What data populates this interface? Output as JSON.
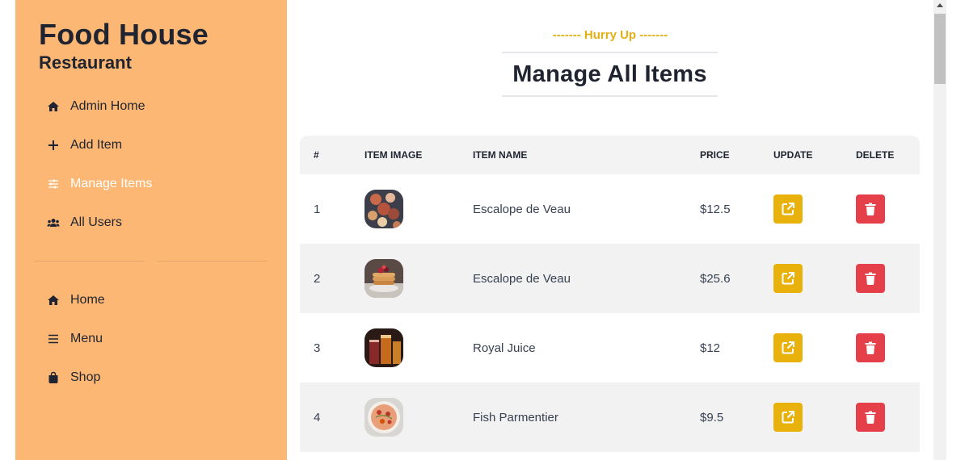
{
  "brand": {
    "title": "Food House",
    "subtitle": "Restaurant"
  },
  "sidebar": {
    "admin_items": [
      {
        "label": "Admin Home",
        "icon": "home-icon"
      },
      {
        "label": "Add Item",
        "icon": "plus-icon"
      },
      {
        "label": "Manage Items",
        "icon": "sliders-icon",
        "active": true
      },
      {
        "label": "All Users",
        "icon": "users-icon"
      }
    ],
    "main_items": [
      {
        "label": "Home",
        "icon": "home-icon"
      },
      {
        "label": "Menu",
        "icon": "menu-icon"
      },
      {
        "label": "Shop",
        "icon": "shopping-bag-icon"
      }
    ]
  },
  "header": {
    "subtitle": "------- Hurry Up -------",
    "title": "Manage All Items"
  },
  "table": {
    "columns": [
      "#",
      "ITEM IMAGE",
      "ITEM NAME",
      "PRICE",
      "UPDATE",
      "DELETE"
    ],
    "rows": [
      {
        "index": "1",
        "name": "Escalope de Veau",
        "price": "$12.5",
        "image": "food-platter-image"
      },
      {
        "index": "2",
        "name": "Escalope de Veau",
        "price": "$25.6",
        "image": "pancake-stack-image"
      },
      {
        "index": "3",
        "name": "Royal Juice",
        "price": "$12",
        "image": "drinks-image"
      },
      {
        "index": "4",
        "name": "Fish Parmentier",
        "price": "$9.5",
        "image": "fish-dish-image"
      }
    ]
  },
  "colors": {
    "sidebar_bg": "#fbb773",
    "accent_yellow": "#e8b10c",
    "delete_red": "#e5404a",
    "header_row_bg": "#f3f3f3"
  }
}
